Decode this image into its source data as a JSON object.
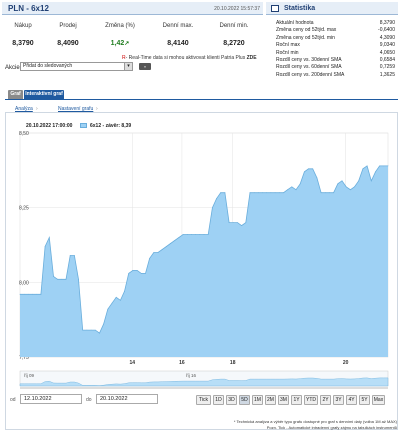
{
  "header": {
    "title": "PLN - 6x12",
    "timestamp": "20.10.2022 15:57:37"
  },
  "quote": {
    "columns": [
      "Nákup",
      "Prodej",
      "Změna (%)",
      "Denní max.",
      "Denní min."
    ],
    "values": [
      "8,3790",
      "8,4090",
      "1,42",
      "8,4140",
      "8,2720"
    ]
  },
  "selector": {
    "label": "Akcie",
    "value": "Přidat do sledovaných",
    "go": "»"
  },
  "realtime_note": {
    "prefix": "R",
    "text": "- Real-Time data si mohou aktivovat klienti Patria Plus ",
    "link": "ZDE"
  },
  "stats": {
    "title": "Statistika",
    "rows": [
      {
        "label": "Aktuální hodnota",
        "value": "8,3790"
      },
      {
        "label": "Změna ceny od 52týd. max",
        "value": "-0,6400"
      },
      {
        "label": "Změna ceny od 52týd. min",
        "value": "4,3090"
      },
      {
        "label": "Roční max",
        "value": "9,0340"
      },
      {
        "label": "Roční min",
        "value": "4,0650"
      },
      {
        "label": "Rozdíl ceny vs. 30denní SMA",
        "value": "0,6584"
      },
      {
        "label": "Rozdíl ceny vs. 60denní SMA",
        "value": "0,7259"
      },
      {
        "label": "Rozdíl ceny vs. 200denní SMA",
        "value": "1,3625"
      }
    ]
  },
  "tabs": [
    "Graf",
    "Interaktivní graf"
  ],
  "breadcrumb": [
    "Analýza",
    "Nastavení grafu"
  ],
  "legend": {
    "date": "20.10.2022 17:00:00",
    "series": "6x12 - závěr: 8,39"
  },
  "chart_data": {
    "type": "area",
    "series": [
      {
        "name": "6x12 - závěr",
        "values": [
          7.96,
          7.96,
          7.96,
          7.96,
          7.96,
          7.96,
          8.12,
          8.15,
          8.02,
          8.01,
          8.01,
          8.01,
          8.09,
          8.09,
          8.01,
          7.84,
          7.84,
          7.84,
          7.84,
          7.83,
          7.86,
          7.91,
          7.93,
          7.95,
          7.94,
          7.97,
          8.03,
          8.04,
          8.04,
          8.03,
          8.03,
          8.08,
          8.1,
          8.1,
          8.11,
          8.12,
          8.13,
          8.14,
          8.15,
          8.16,
          8.16,
          8.16,
          8.16,
          8.16,
          8.16,
          8.16,
          8.25,
          8.28,
          8.3,
          8.3,
          8.2,
          8.2,
          8.2,
          8.19,
          8.2,
          8.3,
          8.3,
          8.3,
          8.3,
          8.3,
          8.3,
          8.3,
          8.3,
          8.3,
          8.31,
          8.32,
          8.31,
          8.33,
          8.37,
          8.38,
          8.38,
          8.35,
          8.3,
          8.3,
          8.3,
          8.3,
          8.33,
          8.34,
          8.32,
          8.31,
          8.32,
          8.34,
          8.38,
          8.39,
          8.34,
          8.37,
          8.39,
          8.39,
          8.39
        ]
      }
    ],
    "x_tick_labels": [
      "14",
      "16",
      "18",
      "20"
    ],
    "y_ticks": [
      7.75,
      8.0,
      8.25,
      8.5
    ],
    "y_tick_labels": [
      "7,75",
      "8,00",
      "8,25",
      "8,50"
    ],
    "ylim": [
      7.75,
      8.5
    ],
    "grid": true,
    "navigator_labels": [
      "říj 09",
      "říj 16"
    ]
  },
  "controls": {
    "from_label": "od",
    "from_value": "12.10.2022",
    "to_label": "do",
    "to_value": "20.10.2022",
    "periods": [
      "Tick",
      "1D",
      "3D",
      "5D",
      "1M",
      "2M",
      "3M",
      "1Y",
      "YTD",
      "2Y",
      "3Y",
      "4Y",
      "5Y",
      "Max"
    ],
    "active_period": "5D"
  },
  "footer": {
    "line1": "* Technická analýza a výběr typu grafu dostupné pro graf s denními daty (volba 1M až MAX)",
    "line2": "Pozn. Tick - Automatické intradenní grafy zájmu na tabulkách instrumentů"
  },
  "colors": {
    "series_fill": "#9ed1f4",
    "series_line": "#6aaedc",
    "accent": "#1f5aa0",
    "positive": "#207d20"
  }
}
